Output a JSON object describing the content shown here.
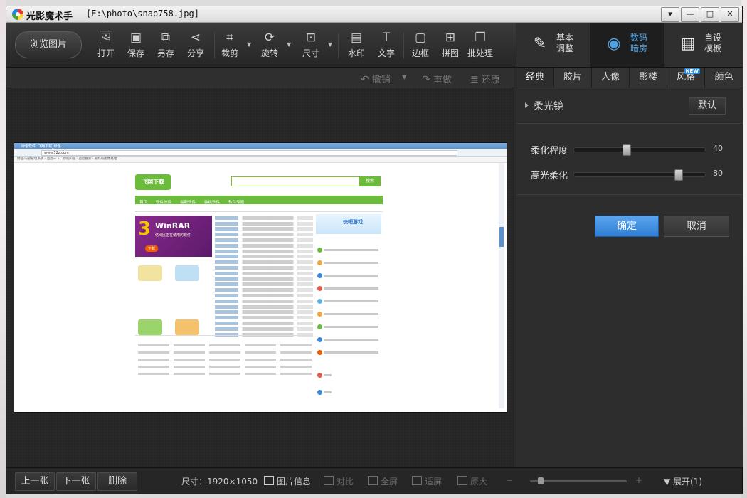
{
  "window": {
    "app_title": "光影魔术手",
    "file_path": "[E:\\photo\\snap758.jpg]",
    "controls": [
      "▾",
      "—",
      "□",
      "✕"
    ]
  },
  "toolbar": {
    "browse_label": "浏览图片",
    "tools": [
      {
        "label": "打开",
        "icon": "open-icon"
      },
      {
        "label": "保存",
        "icon": "save-icon"
      },
      {
        "label": "另存",
        "icon": "save-as-icon"
      },
      {
        "label": "分享",
        "icon": "share-icon"
      },
      {
        "label": "裁剪",
        "icon": "crop-icon"
      },
      {
        "label": "旋转",
        "icon": "rotate-icon"
      },
      {
        "label": "尺寸",
        "icon": "resize-icon"
      },
      {
        "label": "水印",
        "icon": "watermark-icon"
      },
      {
        "label": "文字",
        "icon": "text-icon"
      },
      {
        "label": "边框",
        "icon": "border-icon"
      },
      {
        "label": "拼图",
        "icon": "collage-icon"
      },
      {
        "label": "批处理",
        "icon": "batch-icon"
      }
    ],
    "modes": [
      {
        "line1": "基本",
        "line2": "调整",
        "icon": "basic-adjust-icon",
        "active": false
      },
      {
        "line1": "数码",
        "line2": "暗房",
        "icon": "camera-icon",
        "active": true
      },
      {
        "line1": "自设",
        "line2": "模板",
        "icon": "template-icon",
        "active": false
      }
    ]
  },
  "history": {
    "undo": "撤销",
    "redo": "重做",
    "restore": "还原"
  },
  "image_preview": {
    "browser_tab": "绿色软件, 飞翔下载_绿色…",
    "url": "www.52z.com",
    "bookmarks": "网址·内容管理系统 · 百度一下，你就知道 · 百度搜索 · 最好的图像处理 …",
    "site_logo": "飞翔下载",
    "search_button": "搜索",
    "nav": [
      "首页",
      "软件分类",
      "最新软件",
      "装机软件",
      "软件专题"
    ],
    "banner_number": "3",
    "banner_name": "WinRAR",
    "banner_sub": "亿网民正在使用的软件",
    "banner_cta": "下载",
    "game_label": "快吧游戏"
  },
  "panel": {
    "tabs": [
      {
        "label": "经典",
        "active": true
      },
      {
        "label": "胶片",
        "active": false
      },
      {
        "label": "人像",
        "active": false
      },
      {
        "label": "影楼",
        "active": false
      },
      {
        "label": "风格",
        "active": false,
        "badge": "NEW"
      },
      {
        "label": "颜色",
        "active": false
      }
    ],
    "filter_name": "柔光镜",
    "default_label": "默认",
    "sliders": [
      {
        "label": "柔化程度",
        "value": 40,
        "max": 100,
        "fill": 0.4
      },
      {
        "label": "高光柔化",
        "value": 80,
        "max": 100,
        "fill": 0.8
      }
    ],
    "ok_label": "确定",
    "cancel_label": "取消"
  },
  "statusbar": {
    "prev": "上一张",
    "next": "下一张",
    "delete": "删除",
    "size_label": "尺寸：1920×1050",
    "info": "图片信息",
    "compare": "对比",
    "fullscreen": "全屏",
    "fit": "适屏",
    "original": "原大",
    "zoom_minus": "−",
    "zoom_plus": "+",
    "zoom_level": 0.08,
    "expand": "展开(1)"
  }
}
